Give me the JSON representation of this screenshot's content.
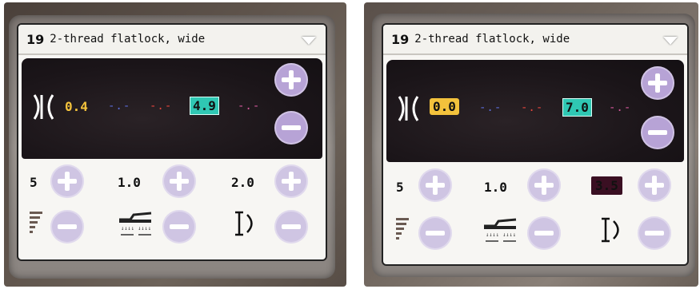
{
  "screens": [
    {
      "stitch": {
        "number": "19",
        "name": "2-thread flatlock, wide"
      },
      "width_row": {
        "value1": "0.4",
        "dash1": "-.-",
        "dash2": "-.-",
        "selected_value": "4.9",
        "dash3": "-.-"
      },
      "lower": {
        "tension": "5",
        "length": "1.0",
        "cutwidth": "2.0"
      }
    },
    {
      "stitch": {
        "number": "19",
        "name": "2-thread flatlock, wide"
      },
      "width_row": {
        "value1": "0.0",
        "dash1": "-.-",
        "dash2": "-.-",
        "selected_value": "7.0",
        "dash3": "-.-"
      },
      "lower": {
        "tension": "5",
        "length": "1.0",
        "cutwidth": "3.5"
      }
    }
  ],
  "colors": {
    "value_yellow": "#f3c23c",
    "dash_blue": "#5a6bd6",
    "dash_red": "#e0443c",
    "dash_pink": "#d2579a",
    "selected_teal": "#2fc7b3",
    "button_purple": "#b7a3d6"
  },
  "icons": [
    "stitch-width-icon",
    "dropdown-arrow-icon",
    "plus-icon",
    "minus-icon",
    "tension-bars-icon",
    "presser-foot-icon",
    "cutting-width-icon"
  ]
}
